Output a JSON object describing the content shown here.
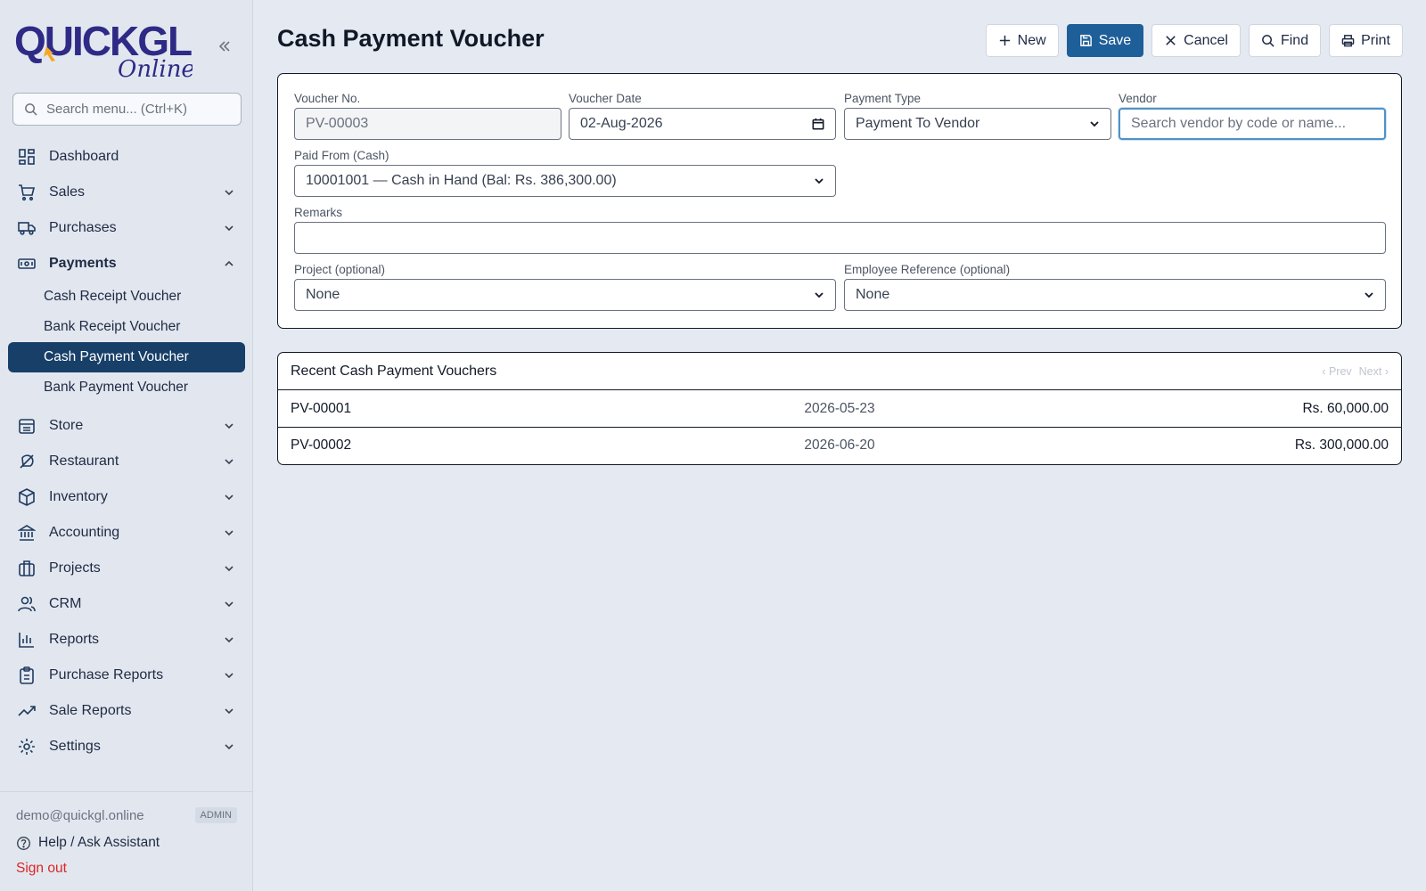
{
  "brand": {
    "logo_text": "QUICKGL",
    "logo_sub": "Online"
  },
  "sidebar": {
    "search_placeholder": "Search menu... (Ctrl+K)",
    "items": [
      {
        "label": "Dashboard",
        "icon": "dashboard-icon",
        "expandable": false
      },
      {
        "label": "Sales",
        "icon": "cart-icon",
        "expandable": true
      },
      {
        "label": "Purchases",
        "icon": "truck-icon",
        "expandable": true
      },
      {
        "label": "Payments",
        "icon": "banknote-icon",
        "expandable": true,
        "expanded": true
      },
      {
        "label": "Store",
        "icon": "store-icon",
        "expandable": true
      },
      {
        "label": "Restaurant",
        "icon": "chef-icon",
        "expandable": true
      },
      {
        "label": "Inventory",
        "icon": "box-icon",
        "expandable": true
      },
      {
        "label": "Accounting",
        "icon": "bank-icon",
        "expandable": true
      },
      {
        "label": "Projects",
        "icon": "briefcase-icon",
        "expandable": true
      },
      {
        "label": "CRM",
        "icon": "users-icon",
        "expandable": true
      },
      {
        "label": "Reports",
        "icon": "bar-chart-icon",
        "expandable": true
      },
      {
        "label": "Purchase Reports",
        "icon": "clipboard-icon",
        "expandable": true
      },
      {
        "label": "Sale Reports",
        "icon": "trending-up-icon",
        "expandable": true
      },
      {
        "label": "Settings",
        "icon": "gear-icon",
        "expandable": true
      }
    ],
    "payments_sub": [
      {
        "label": "Cash Receipt Voucher"
      },
      {
        "label": "Bank Receipt Voucher"
      },
      {
        "label": "Cash Payment Voucher",
        "active": true
      },
      {
        "label": "Bank Payment Voucher"
      }
    ],
    "footer": {
      "email": "demo@quickgl.online",
      "role": "ADMIN",
      "help": "Help / Ask Assistant",
      "signout": "Sign out"
    }
  },
  "page": {
    "title": "Cash Payment Voucher"
  },
  "toolbar": {
    "new_label": "New",
    "save_label": "Save",
    "cancel_label": "Cancel",
    "find_label": "Find",
    "print_label": "Print"
  },
  "form": {
    "voucher_no": {
      "label": "Voucher No.",
      "value": "PV-00003"
    },
    "voucher_date": {
      "label": "Voucher Date",
      "value": "02-Aug-2026"
    },
    "payment_type": {
      "label": "Payment Type",
      "value": "Payment To Vendor"
    },
    "vendor": {
      "label": "Vendor",
      "placeholder": "Search vendor by code or name...",
      "value": ""
    },
    "paid_from": {
      "label": "Paid From (Cash)",
      "value": "10001001 — Cash in Hand (Bal: Rs. 386,300.00)"
    },
    "remarks": {
      "label": "Remarks",
      "value": ""
    },
    "project": {
      "label": "Project (optional)",
      "value": "None"
    },
    "employee": {
      "label": "Employee Reference (optional)",
      "value": "None"
    }
  },
  "recent": {
    "title": "Recent Cash Payment Vouchers",
    "prev": "‹ Prev",
    "next": "Next ›",
    "rows": [
      {
        "no": "PV-00001",
        "date": "2026-05-23",
        "amount": "Rs. 60,000.00"
      },
      {
        "no": "PV-00002",
        "date": "2026-06-20",
        "amount": "Rs. 300,000.00"
      }
    ]
  },
  "colors": {
    "accent": "#1f5f99",
    "active_nav": "#173f68",
    "signout": "#dc2626",
    "logo_primary": "#2e2a86",
    "logo_accent": "#f5a623"
  }
}
